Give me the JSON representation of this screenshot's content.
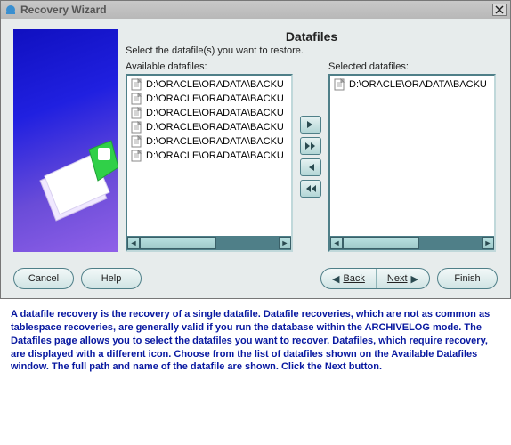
{
  "window": {
    "title": "Recovery Wizard"
  },
  "page": {
    "title": "Datafiles",
    "subtitle": "Select the datafile(s) you want to restore."
  },
  "available": {
    "label": "Available datafiles:",
    "items": [
      "D:\\ORACLE\\ORADATA\\BACKU",
      "D:\\ORACLE\\ORADATA\\BACKU",
      "D:\\ORACLE\\ORADATA\\BACKU",
      "D:\\ORACLE\\ORADATA\\BACKU",
      "D:\\ORACLE\\ORADATA\\BACKU",
      "D:\\ORACLE\\ORADATA\\BACKU"
    ]
  },
  "selected": {
    "label": "Selected datafiles:",
    "items": [
      "D:\\ORACLE\\ORADATA\\BACKU"
    ]
  },
  "buttons": {
    "cancel": "Cancel",
    "help": "Help",
    "back": "Back",
    "next": "Next",
    "finish": "Finish"
  },
  "description": "A datafile recovery is the recovery of a single datafile. Datafile recoveries, which are not as common as tablespace recoveries, are generally valid if you run the database within the ARCHIVELOG mode. The Datafiles page allows you to select the datafiles you want to recover. Datafiles, which require recovery, are displayed with a different icon. Choose from the list of datafiles shown on the Available Datafiles window. The full path and name of the datafile are shown. Click the Next button."
}
